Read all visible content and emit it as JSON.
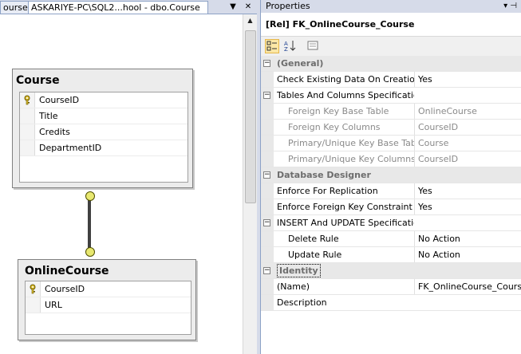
{
  "designer": {
    "tabs": [
      {
        "label": "ourse"
      },
      {
        "label": "ASKARIYE-PC\\SQL2...hool - dbo.Course"
      }
    ],
    "dropdown_glyph": "▼",
    "close_glyph": "✕",
    "entities": {
      "course": {
        "title": "Course",
        "columns": [
          "CourseID",
          "Title",
          "Credits",
          "DepartmentID"
        ]
      },
      "online_course": {
        "title": "OnlineCourse",
        "columns": [
          "CourseID",
          "URL"
        ]
      }
    }
  },
  "properties": {
    "title": "Properties",
    "pin_glyph": "▾ ⊣",
    "object_name": "[Rel] FK_OnlineCourse_Course",
    "rows": [
      {
        "kind": "category",
        "toggle": "−",
        "label": "(General)",
        "value": ""
      },
      {
        "kind": "prop",
        "label": "Check Existing Data On Creation",
        "value": "Yes"
      },
      {
        "kind": "expand",
        "toggle": "−",
        "label": "Tables And Columns Specificatio",
        "value": ""
      },
      {
        "kind": "sub-dim",
        "label": "Foreign Key Base Table",
        "value": "OnlineCourse"
      },
      {
        "kind": "sub-dim",
        "label": "Foreign Key Columns",
        "value": "CourseID"
      },
      {
        "kind": "sub-dim",
        "label": "Primary/Unique Key Base Tab",
        "value": "Course"
      },
      {
        "kind": "sub-dim",
        "label": "Primary/Unique Key Columns",
        "value": "CourseID"
      },
      {
        "kind": "category",
        "toggle": "−",
        "label": "Database Designer",
        "value": ""
      },
      {
        "kind": "prop",
        "label": "Enforce For Replication",
        "value": "Yes"
      },
      {
        "kind": "prop",
        "label": "Enforce Foreign Key Constraint",
        "value": "Yes"
      },
      {
        "kind": "expand",
        "toggle": "−",
        "label": "INSERT And UPDATE Specificatio",
        "value": ""
      },
      {
        "kind": "sub",
        "label": "Delete Rule",
        "value": "No Action"
      },
      {
        "kind": "sub",
        "label": "Update Rule",
        "value": "No Action"
      },
      {
        "kind": "category-identity",
        "toggle": "−",
        "label": "Identity",
        "value": ""
      },
      {
        "kind": "prop",
        "label": "(Name)",
        "value": "FK_OnlineCourse_Course"
      },
      {
        "kind": "prop",
        "label": "Description",
        "value": ""
      }
    ]
  }
}
